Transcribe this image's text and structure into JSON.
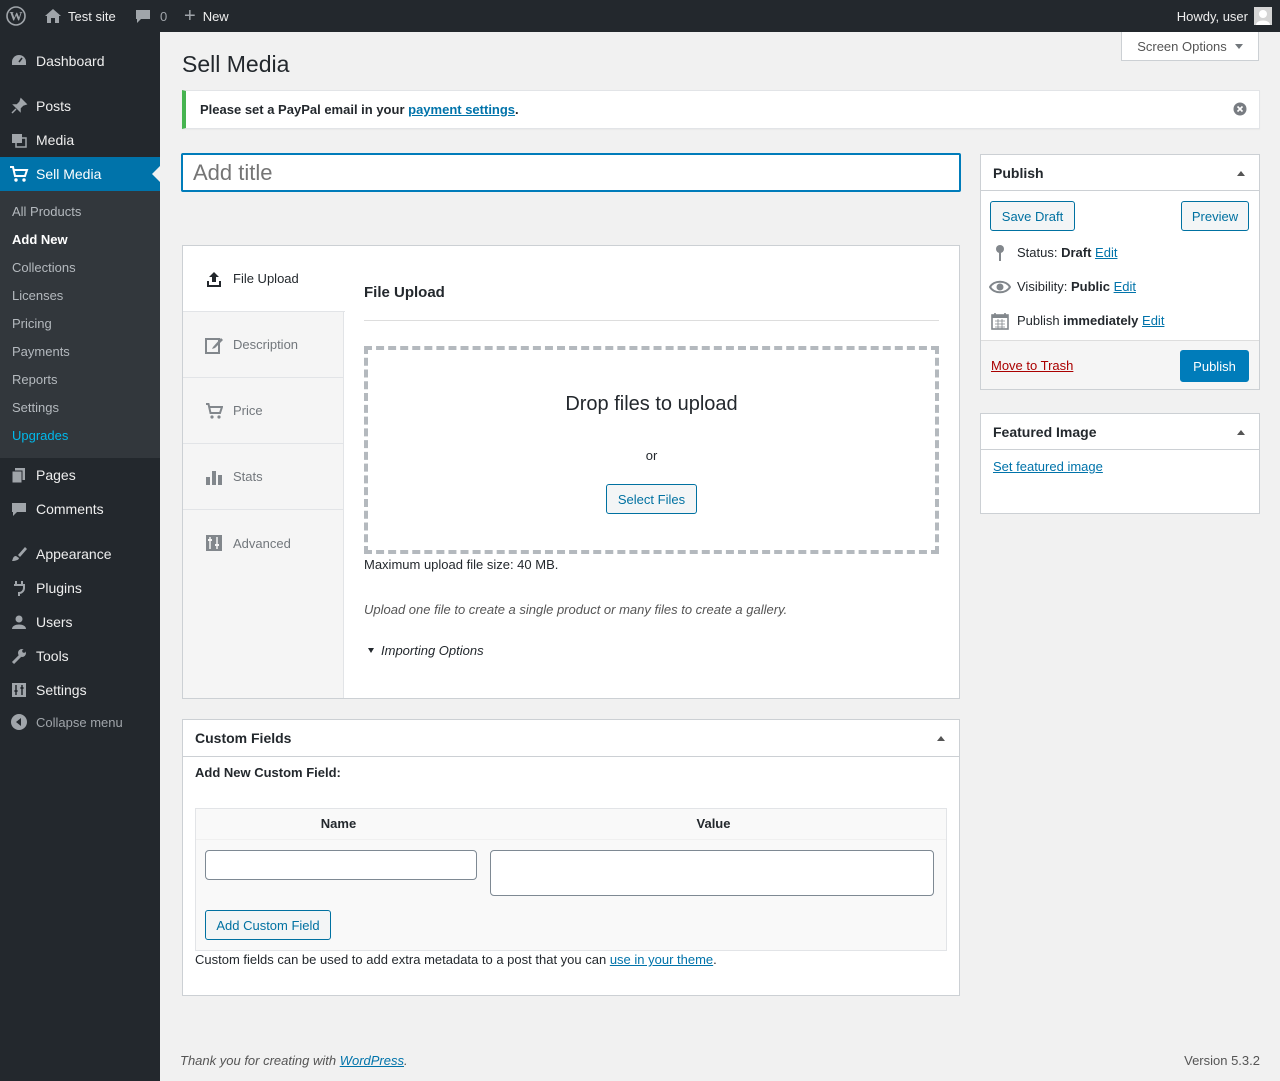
{
  "adminbar": {
    "site_name": "Test site",
    "comments_count": "0",
    "new_label": "New",
    "howdy": "Howdy, user"
  },
  "menu": {
    "dashboard": "Dashboard",
    "posts": "Posts",
    "media": "Media",
    "sell_media": "Sell Media",
    "submenu": [
      "All Products",
      "Add New",
      "Collections",
      "Licenses",
      "Pricing",
      "Payments",
      "Reports",
      "Settings",
      "Upgrades"
    ],
    "pages": "Pages",
    "comments": "Comments",
    "appearance": "Appearance",
    "plugins": "Plugins",
    "users": "Users",
    "tools": "Tools",
    "settings": "Settings",
    "collapse": "Collapse menu"
  },
  "screen_options": "Screen Options",
  "page_title": "Sell Media",
  "notice": {
    "text": "Please set a PayPal email in your ",
    "link": "payment settings",
    "end": "."
  },
  "title_placeholder": "Add title",
  "tabs": [
    "File Upload",
    "Description",
    "Price",
    "Stats",
    "Advanced"
  ],
  "upload": {
    "heading": "File Upload",
    "drop": "Drop files to upload",
    "or": "or",
    "select": "Select Files",
    "max": "Maximum upload file size: 40 MB.",
    "hint": "Upload one file to create a single product or many files to create a gallery.",
    "importing": "Importing Options"
  },
  "custom_fields": {
    "title": "Custom Fields",
    "add_new": "Add New Custom Field:",
    "name_col": "Name",
    "value_col": "Value",
    "add_button": "Add Custom Field",
    "help": "Custom fields can be used to add extra metadata to a post that you can ",
    "help_link": "use in your theme",
    "help_end": "."
  },
  "publish": {
    "title": "Publish",
    "save_draft": "Save Draft",
    "preview": "Preview",
    "status_label": "Status: ",
    "status_value": "Draft",
    "visibility_label": "Visibility: ",
    "visibility_value": "Public",
    "publish_label": "Publish ",
    "publish_value": "immediately",
    "edit": "Edit",
    "trash": "Move to Trash",
    "publish_button": "Publish"
  },
  "featured": {
    "title": "Featured Image",
    "link": "Set featured image"
  },
  "footer": {
    "thanks": "Thank you for creating with ",
    "wp": "WordPress",
    "end": ".",
    "version": "Version 5.3.2"
  },
  "colors": {
    "accent": "#0073aa",
    "menu_bg": "#23282d",
    "notice_border": "#46b450"
  }
}
